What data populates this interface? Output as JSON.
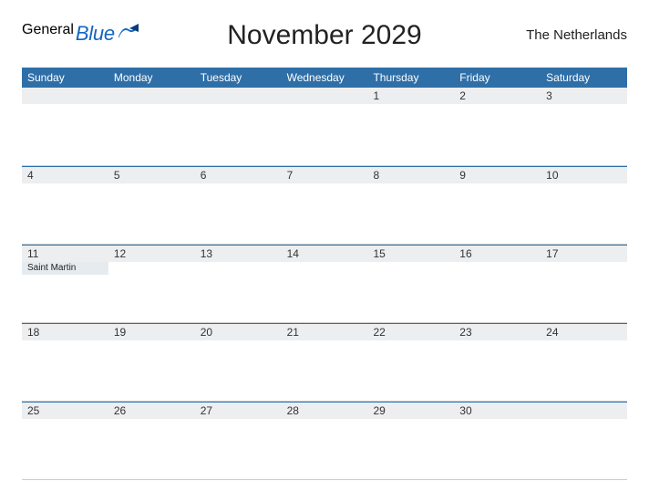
{
  "brand": {
    "part1": "General",
    "part2": "Blue"
  },
  "title": "November 2029",
  "region": "The Netherlands",
  "days_of_week": [
    "Sunday",
    "Monday",
    "Tuesday",
    "Wednesday",
    "Thursday",
    "Friday",
    "Saturday"
  ],
  "weeks": [
    {
      "cells": [
        {
          "date": "",
          "holiday": ""
        },
        {
          "date": "",
          "holiday": ""
        },
        {
          "date": "",
          "holiday": ""
        },
        {
          "date": "",
          "holiday": ""
        },
        {
          "date": "1",
          "holiday": ""
        },
        {
          "date": "2",
          "holiday": ""
        },
        {
          "date": "3",
          "holiday": ""
        }
      ]
    },
    {
      "cells": [
        {
          "date": "4",
          "holiday": ""
        },
        {
          "date": "5",
          "holiday": ""
        },
        {
          "date": "6",
          "holiday": ""
        },
        {
          "date": "7",
          "holiday": ""
        },
        {
          "date": "8",
          "holiday": ""
        },
        {
          "date": "9",
          "holiday": ""
        },
        {
          "date": "10",
          "holiday": ""
        }
      ]
    },
    {
      "cells": [
        {
          "date": "11",
          "holiday": "Saint Martin"
        },
        {
          "date": "12",
          "holiday": ""
        },
        {
          "date": "13",
          "holiday": ""
        },
        {
          "date": "14",
          "holiday": ""
        },
        {
          "date": "15",
          "holiday": ""
        },
        {
          "date": "16",
          "holiday": ""
        },
        {
          "date": "17",
          "holiday": ""
        }
      ]
    },
    {
      "cells": [
        {
          "date": "18",
          "holiday": ""
        },
        {
          "date": "19",
          "holiday": ""
        },
        {
          "date": "20",
          "holiday": ""
        },
        {
          "date": "21",
          "holiday": ""
        },
        {
          "date": "22",
          "holiday": ""
        },
        {
          "date": "23",
          "holiday": ""
        },
        {
          "date": "24",
          "holiday": ""
        }
      ]
    },
    {
      "cells": [
        {
          "date": "25",
          "holiday": ""
        },
        {
          "date": "26",
          "holiday": ""
        },
        {
          "date": "27",
          "holiday": ""
        },
        {
          "date": "28",
          "holiday": ""
        },
        {
          "date": "29",
          "holiday": ""
        },
        {
          "date": "30",
          "holiday": ""
        },
        {
          "date": "",
          "holiday": ""
        }
      ]
    }
  ]
}
